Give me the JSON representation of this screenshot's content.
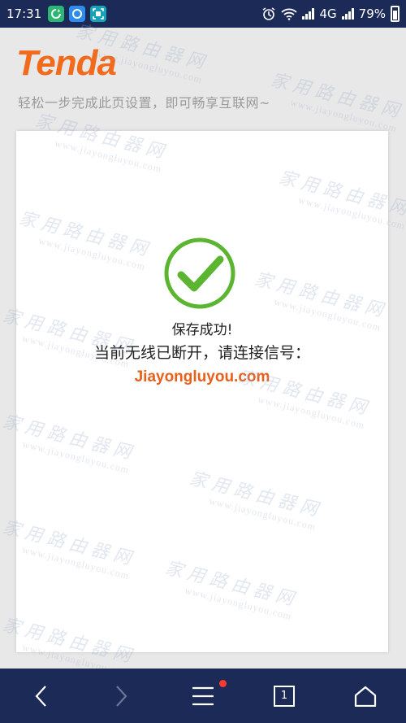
{
  "status_bar": {
    "time": "17:31",
    "network": "4G",
    "battery": "79%"
  },
  "header": {
    "brand": "Tenda",
    "tagline": "轻松一步完成此页设置，即可畅享互联网~"
  },
  "card": {
    "message_saved": "保存成功!",
    "message_disconnected": "当前无线已断开，请连接信号：",
    "ssid": "Jiayongluyou.com"
  },
  "watermark": {
    "cn": "家用路由器网",
    "en": "www.jiayongluyou.com"
  },
  "nav": {
    "tabs_count": "1"
  },
  "colors": {
    "status_bg": "#1b2a57",
    "brand_orange": "#e8601c",
    "success_green": "#5cb531"
  }
}
